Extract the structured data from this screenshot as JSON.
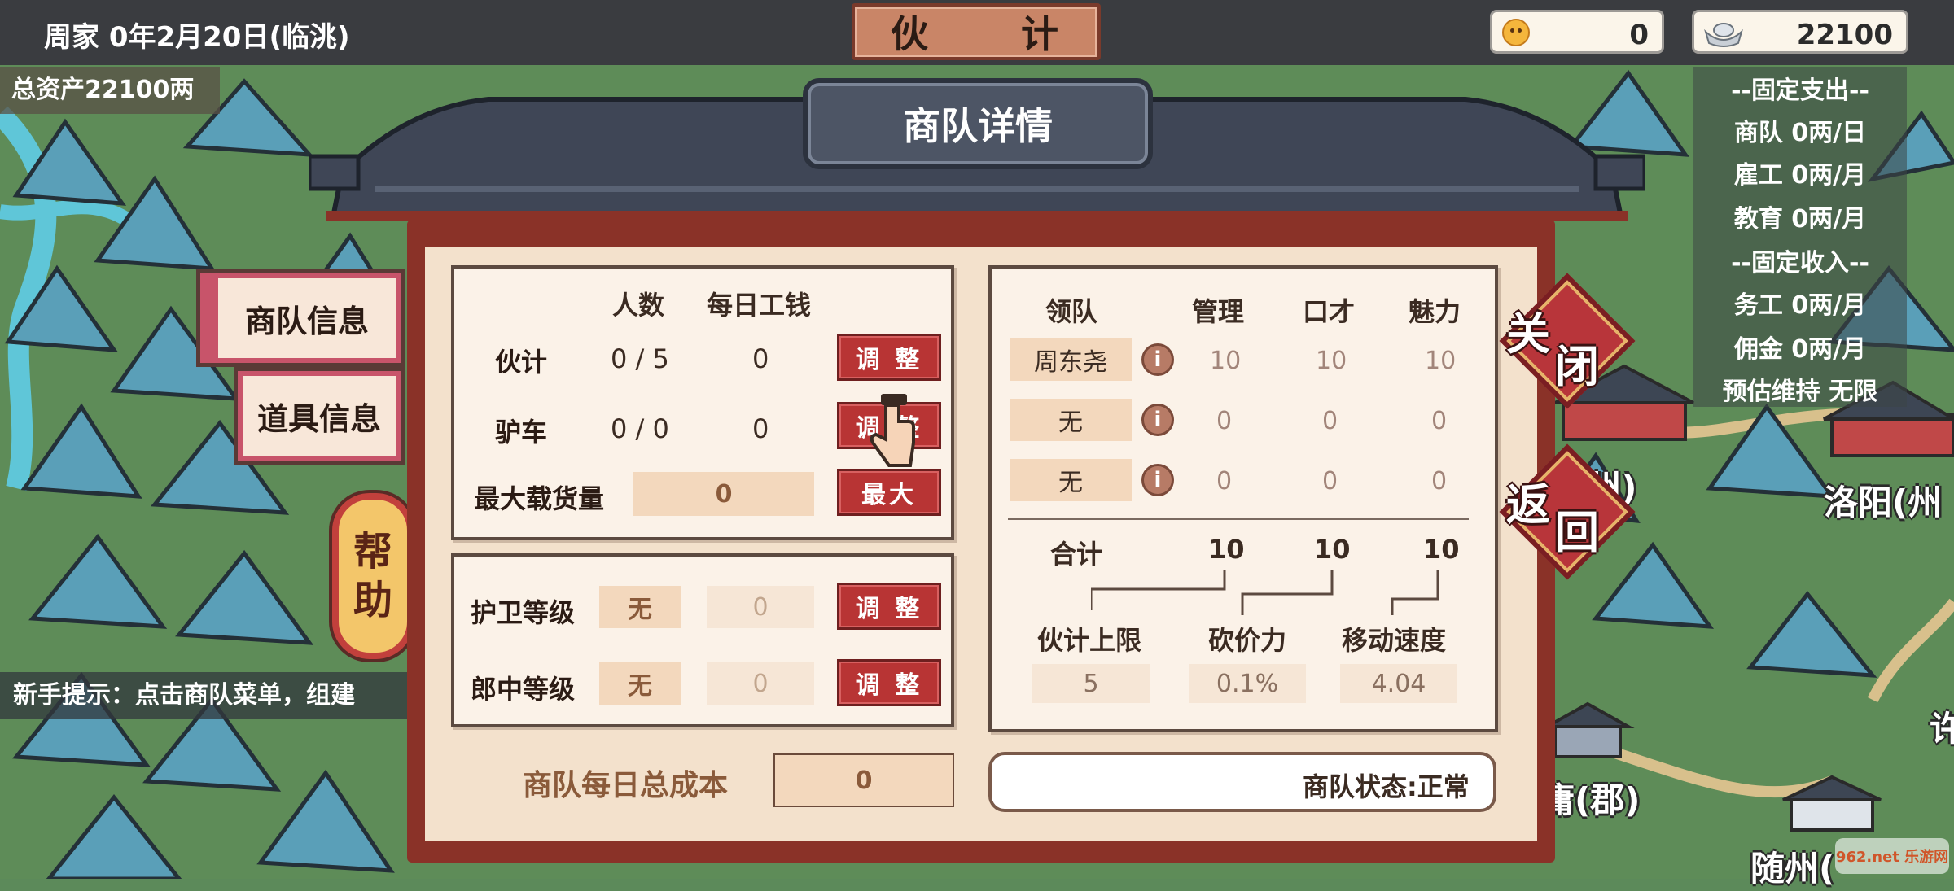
{
  "topbar": {
    "date": "周家 0年2月20日(临洮)",
    "title": "伙　计",
    "coins": "0",
    "silver": "22100"
  },
  "left": {
    "total_assets": "总资产22100两",
    "hint": "新手提示：点击商队菜单，组建"
  },
  "fixed": {
    "expense_header": "--固定支出--",
    "caravan": "商队  0两/日",
    "hired": "雇工  0两/月",
    "education": "教育  0两/月",
    "income_header": "--固定收入--",
    "work": "务工 0两/月",
    "commission": "佣金 0两/月",
    "estimate": "预估维持 无限"
  },
  "map_cities": [
    "(州)",
    "洛阳(州",
    "庸(郡)",
    "随州(",
    "许"
  ],
  "tabs": {
    "caravan_info": "商队信息",
    "item_info": "道具信息",
    "help": [
      "帮",
      "助"
    ]
  },
  "panel": {
    "title": "商队详情",
    "close": [
      "关",
      "闭"
    ],
    "back": [
      "返",
      "回"
    ],
    "staff": {
      "col_count": "人数",
      "col_wage": "每日工钱",
      "rows": [
        {
          "label": "伙计",
          "count": "0 / 5",
          "wage": "0",
          "btn": "调 整"
        },
        {
          "label": "驴车",
          "count": "0 / 0",
          "wage": "0",
          "btn": "调 整"
        }
      ],
      "max_cargo_label": "最大载货量",
      "max_cargo_value": "0",
      "max_btn": "最大"
    },
    "guards": [
      {
        "label": "护卫等级",
        "level": "无",
        "value": "0",
        "btn": "调 整"
      },
      {
        "label": "郎中等级",
        "level": "无",
        "value": "0",
        "btn": "调 整"
      }
    ],
    "daily_cost_label": "商队每日总成本",
    "daily_cost_value": "0",
    "leader": {
      "col_leader": "领队",
      "col_manage": "管理",
      "col_speech": "口才",
      "col_charm": "魅力",
      "rows": [
        {
          "name": "周东尧",
          "manage": "10",
          "speech": "10",
          "charm": "10"
        },
        {
          "name": "无",
          "manage": "0",
          "speech": "0",
          "charm": "0"
        },
        {
          "name": "无",
          "manage": "0",
          "speech": "0",
          "charm": "0"
        }
      ],
      "total_label": "合计",
      "total_manage": "10",
      "total_speech": "10",
      "total_charm": "10",
      "stat_labels": [
        "伙计上限",
        "砍价力",
        "移动速度"
      ],
      "stat_values": [
        "5",
        "0.1%",
        "4.04"
      ]
    },
    "status": "商队状态:正常"
  },
  "watermark": "962.net 乐游网",
  "colors": {
    "accent_red": "#b83434",
    "paper": "#fbf2e8",
    "frame": "#8a3228",
    "roof": "#4d5565"
  }
}
